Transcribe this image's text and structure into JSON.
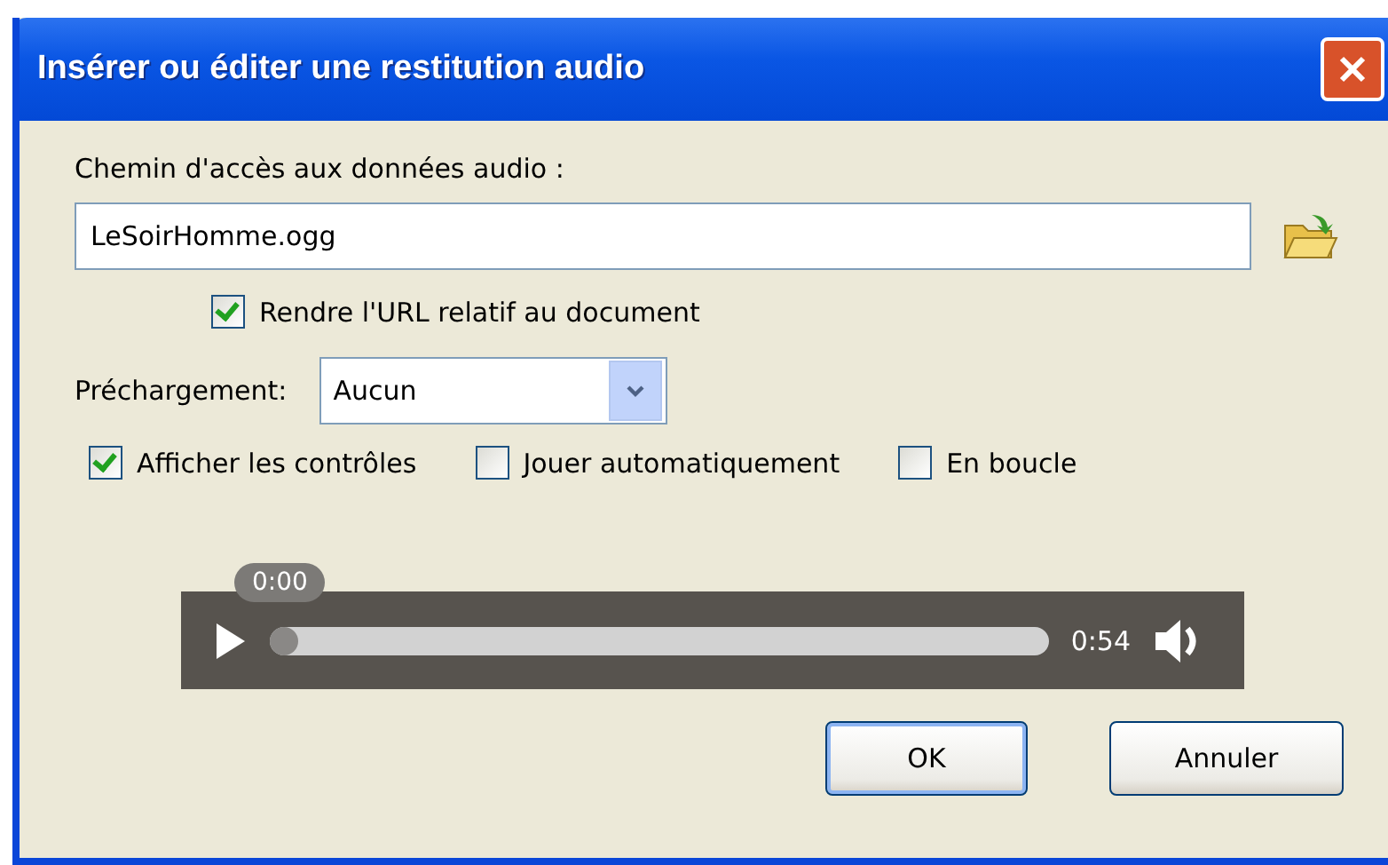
{
  "window": {
    "title": "Insérer ou éditer une restitution audio"
  },
  "path": {
    "label": "Chemin d'accès aux données audio :",
    "value": "LeSoirHomme.ogg"
  },
  "relative": {
    "label": "Rendre l'URL relatif au document",
    "checked": true
  },
  "preload": {
    "label": "Préchargement:",
    "value": "Aucun"
  },
  "options": [
    {
      "label": "Afficher les contrôles",
      "checked": true
    },
    {
      "label": "Jouer automatiquement",
      "checked": false
    },
    {
      "label": "En boucle",
      "checked": false
    }
  ],
  "player": {
    "current": "0:00",
    "duration": "0:54",
    "level": 0
  },
  "buttons": [
    {
      "label": "OK",
      "default": true
    },
    {
      "label": "Annuler",
      "default": false
    }
  ]
}
